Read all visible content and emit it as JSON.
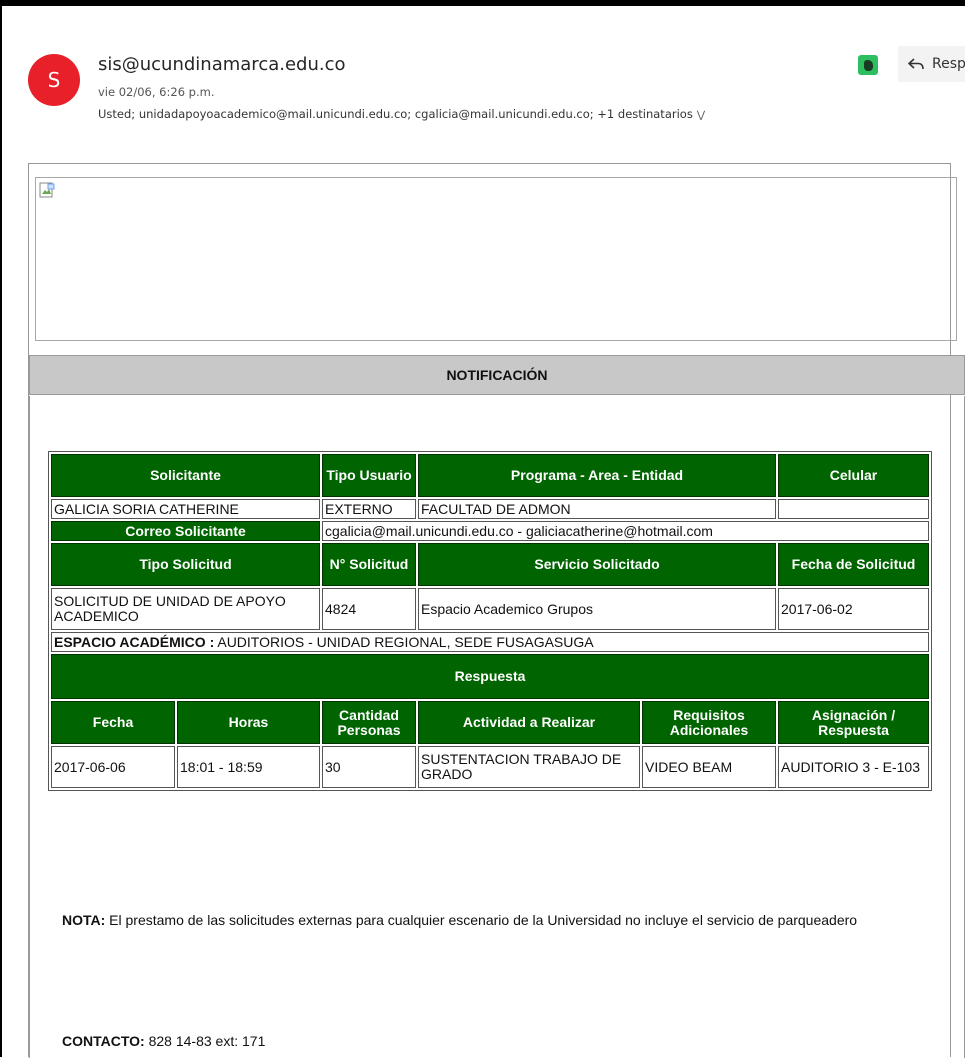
{
  "email": {
    "avatar_letter": "S",
    "sender": "sis@ucundinamarca.edu.co",
    "date": "vie 02/06, 6:26 p.m.",
    "recipients": "Usted; unidadapoyoacademico@mail.unicundi.edu.co; cgalicia@mail.unicundi.edu.co; +1 destinatarios",
    "expand_icon": "double-chevron-down-icon",
    "reply_label": "Responder",
    "colors": {
      "avatar": "#e8202a",
      "header_green": "#006400",
      "evernote": "#2dbe60"
    }
  },
  "body": {
    "notification_title": "NOTIFICACIÓN",
    "table": {
      "h_solicitante": "Solicitante",
      "h_tipo_usuario": "Tipo Usuario",
      "h_programa": "Programa - Area - Entidad",
      "h_celular": "Celular",
      "solicitante": "GALICIA SORIA CATHERINE",
      "tipo_usuario": "EXTERNO",
      "programa": "FACULTAD DE ADMON",
      "celular": "",
      "h_correo": "Correo Solicitante",
      "correo": "cgalicia@mail.unicundi.edu.co - galiciacatherine@hotmail.com",
      "h_tipo_solicitud": "Tipo Solicitud",
      "h_num_solicitud": "N° Solicitud",
      "h_servicio": "Servicio Solicitado",
      "h_fecha_solicitud": "Fecha de Solicitud",
      "tipo_solicitud": "SOLICITUD DE UNIDAD DE APOYO ACADEMICO",
      "num_solicitud": "4824",
      "servicio": "Espacio Academico Grupos",
      "fecha_solicitud": "2017-06-02",
      "espacio_label": "ESPACIO ACADÉMICO :",
      "espacio_value": " AUDITORIOS - UNIDAD REGIONAL, SEDE FUSAGASUGA",
      "h_respuesta": "Respuesta",
      "h_fecha": "Fecha",
      "h_horas": "Horas",
      "h_cantidad": "Cantidad Personas",
      "h_actividad": "Actividad a Realizar",
      "h_requisitos": "Requisitos Adicionales",
      "h_asignacion": "Asignación / Respuesta",
      "fecha": "2017-06-06",
      "horas": "18:01 - 18:59",
      "cantidad": "30",
      "actividad": "SUSTENTACION TRABAJO DE GRADO",
      "requisitos": "VIDEO BEAM",
      "asignacion": "AUDITORIO 3 - E-103"
    },
    "nota_label": "NOTA:",
    "nota_text": " El prestamo de las solicitudes externas para cualquier escenario de la Universidad no incluye el servicio de parqueadero",
    "contacto_label": "CONTACTO:",
    "contacto_value": " 828 14-83 ext: 171"
  }
}
